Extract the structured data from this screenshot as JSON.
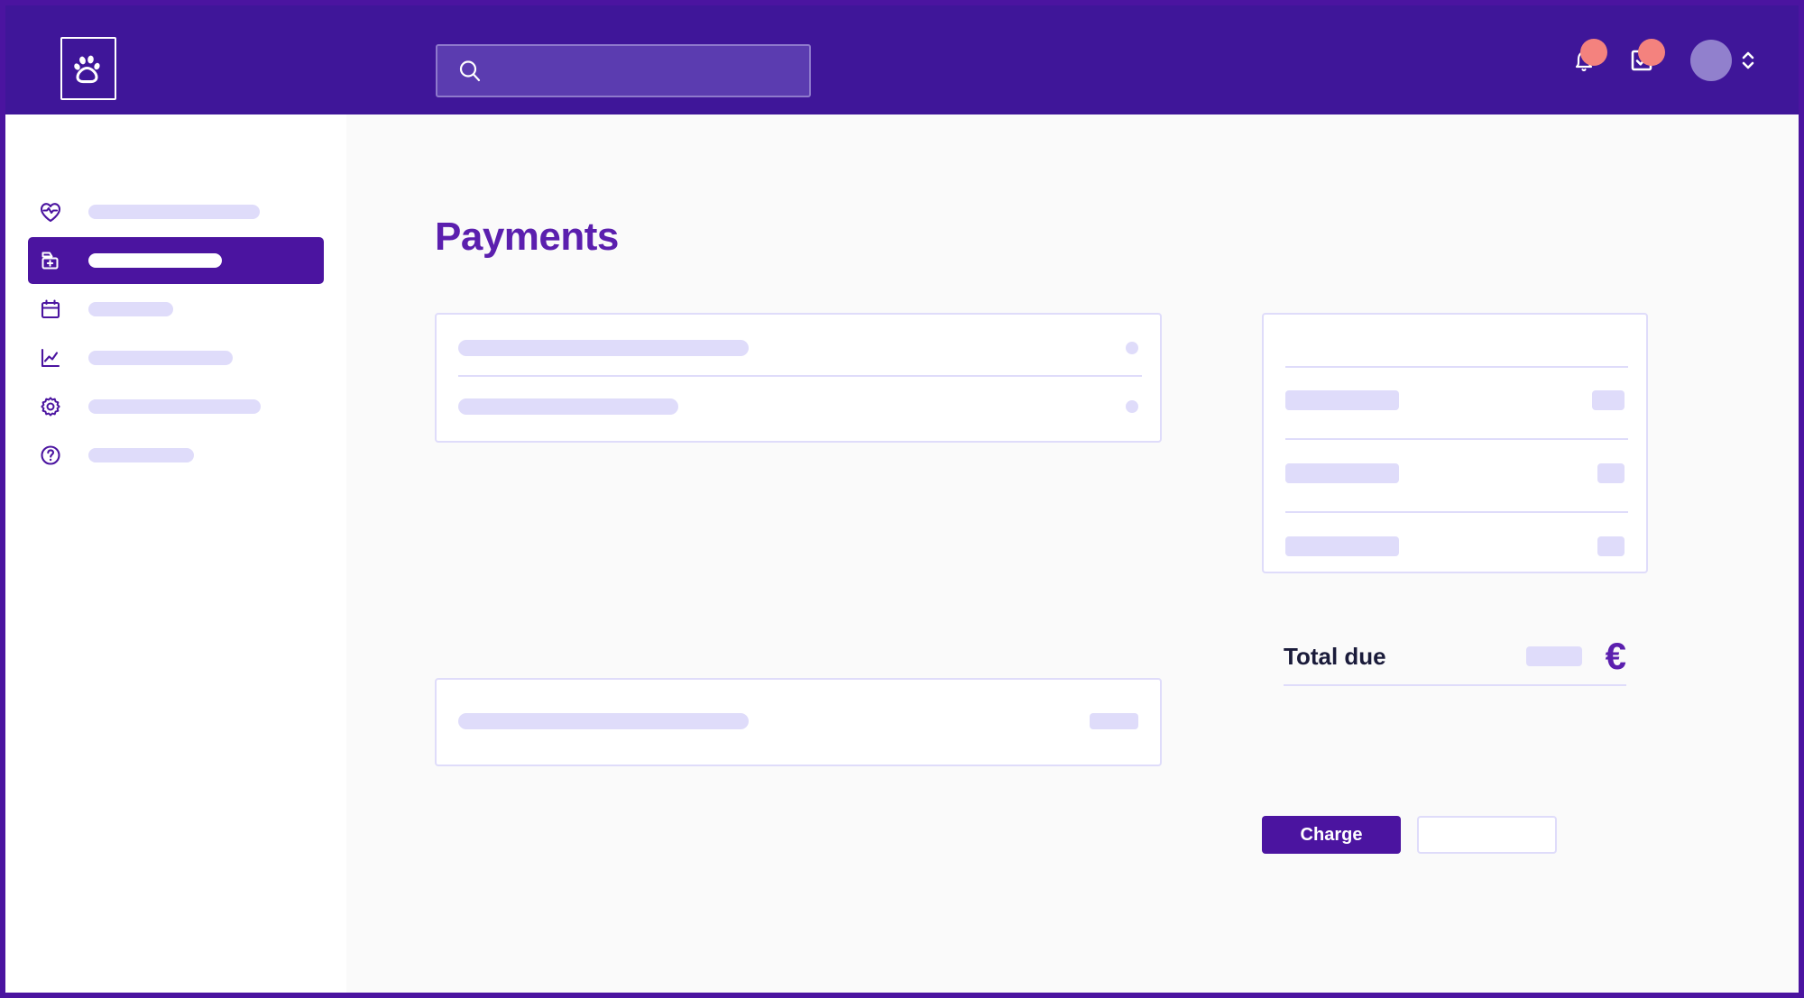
{
  "app": {
    "logo_icon": "paw-print-icon",
    "border_color": "#4B14A0",
    "header_color": "#3F1699",
    "accent_color": "#5B1FAE",
    "skeleton_color": "#DFDCFA",
    "badge_color": "#F4827E",
    "avatar_color": "#9180CD"
  },
  "header": {
    "search": {
      "value": "",
      "placeholder": "",
      "icon": "search-icon"
    },
    "notifications": {
      "icon": "bell-icon",
      "has_badge": true
    },
    "tasks": {
      "icon": "checkbox-checked-icon",
      "has_badge": true
    },
    "account": {
      "avatar_icon": "avatar",
      "chevron_icon": "chevron-up-down-icon"
    }
  },
  "sidebar": {
    "items": [
      {
        "icon": "heart-pulse-icon",
        "label": "",
        "label_width": 190,
        "active": false
      },
      {
        "icon": "medical-bag-plus-icon",
        "label": "",
        "label_width": 148,
        "active": true
      },
      {
        "icon": "calendar-icon",
        "label": "",
        "label_width": 94,
        "active": false
      },
      {
        "icon": "line-chart-icon",
        "label": "",
        "label_width": 160,
        "active": false
      },
      {
        "icon": "gear-icon",
        "label": "",
        "label_width": 191,
        "active": false
      },
      {
        "icon": "help-circle-icon",
        "label": "",
        "label_width": 117,
        "active": false
      }
    ]
  },
  "main": {
    "title": "Payments",
    "payment_methods_card": {
      "rows": [
        {
          "label_width": 322,
          "selector": "radio-dot"
        },
        {
          "label_width": 244,
          "selector": "radio-dot"
        }
      ]
    },
    "extra_card": {
      "rows": [
        {
          "label_width": 322,
          "value_width": 54
        }
      ]
    },
    "invoice_card": {
      "line_items": [
        {
          "label_width": 126,
          "amount_width": 36
        },
        {
          "label_width": 126,
          "amount_width": 30
        },
        {
          "label_width": 126,
          "amount_width": 30
        }
      ]
    },
    "total": {
      "label": "Total due",
      "amount": "",
      "currency_symbol": "€"
    },
    "actions": {
      "charge_label": "Charge",
      "secondary_label": ""
    }
  }
}
